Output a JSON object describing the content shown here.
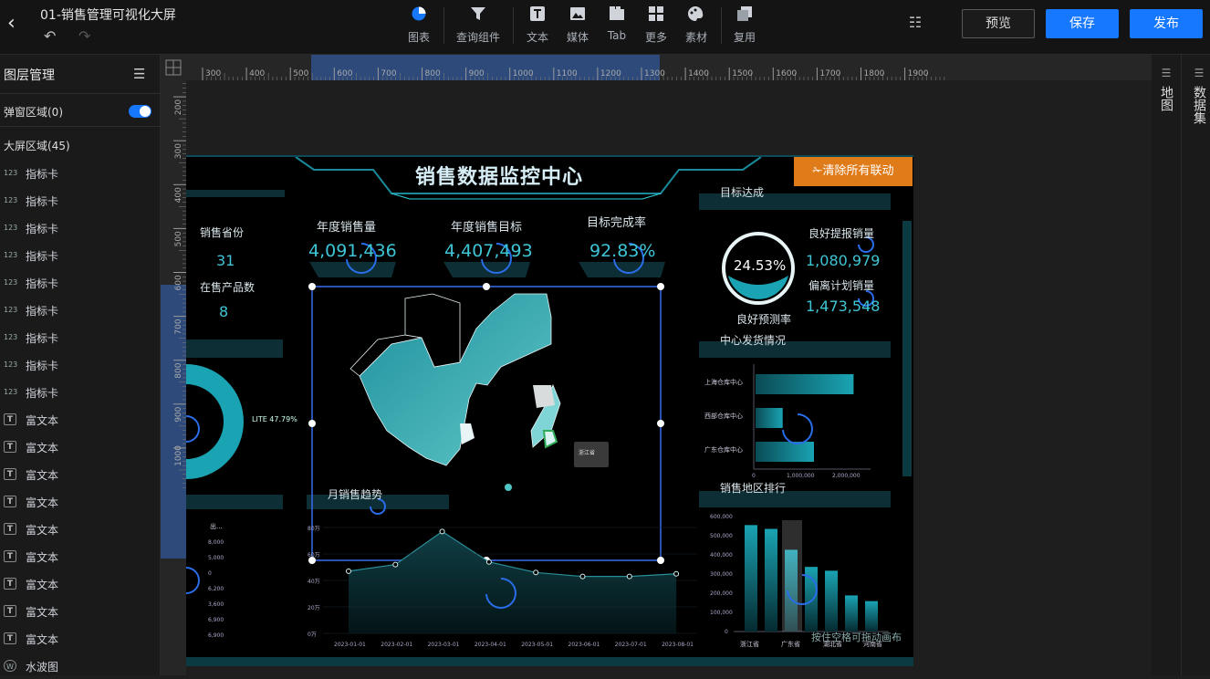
{
  "header": {
    "title": "01-销售管理可视化大屏",
    "back_icon": "chevron-left-icon",
    "undo_icon": "undo-icon",
    "redo_icon": "redo-icon"
  },
  "toolbar": {
    "items": [
      {
        "label": "图表",
        "icon": "pie-chart-icon"
      },
      {
        "label": "查询组件",
        "icon": "funnel-icon"
      },
      {
        "label": "文本",
        "icon": "text-icon"
      },
      {
        "label": "媒体",
        "icon": "image-icon"
      },
      {
        "label": "Tab",
        "icon": "tab-icon"
      },
      {
        "label": "更多",
        "icon": "grid-icon"
      },
      {
        "label": "素材",
        "icon": "palette-icon"
      },
      {
        "label": "复用",
        "icon": "copy-icon"
      }
    ]
  },
  "actions": {
    "preview": "预览",
    "save": "保存",
    "publish": "发布"
  },
  "colors": {
    "accent": "#1677ff",
    "teal": "#3ec5d6",
    "orange": "#e07b1a"
  },
  "left_panel": {
    "title": "图层管理",
    "popup_area": "弹窗区域(0)",
    "big_area": "大屏区域(45)",
    "layers": [
      {
        "type": "123",
        "name": "指标卡"
      },
      {
        "type": "123",
        "name": "指标卡"
      },
      {
        "type": "123",
        "name": "指标卡"
      },
      {
        "type": "123",
        "name": "指标卡"
      },
      {
        "type": "123",
        "name": "指标卡"
      },
      {
        "type": "123",
        "name": "指标卡"
      },
      {
        "type": "123",
        "name": "指标卡"
      },
      {
        "type": "123",
        "name": "指标卡"
      },
      {
        "type": "123",
        "name": "指标卡"
      },
      {
        "type": "T",
        "name": "富文本"
      },
      {
        "type": "T",
        "name": "富文本"
      },
      {
        "type": "T",
        "name": "富文本"
      },
      {
        "type": "T",
        "name": "富文本"
      },
      {
        "type": "T",
        "name": "富文本"
      },
      {
        "type": "T",
        "name": "富文本"
      },
      {
        "type": "T",
        "name": "富文本"
      },
      {
        "type": "T",
        "name": "富文本"
      },
      {
        "type": "T",
        "name": "富文本"
      },
      {
        "type": "W",
        "name": "水波图"
      }
    ]
  },
  "right_panel": {
    "map": "地图",
    "dataset": "数据集"
  },
  "ruler": {
    "top_ticks": [
      "300",
      "400",
      "500",
      "600",
      "700",
      "800",
      "900",
      "1000",
      "1100",
      "1200",
      "1300",
      "1400",
      "1500",
      "1600",
      "1700",
      "1800",
      "1900"
    ],
    "left_ticks": [
      "100",
      "200",
      "300",
      "400",
      "500",
      "600",
      "700",
      "800",
      "900",
      "1000"
    ]
  },
  "dashboard": {
    "title": "销售数据监控中心",
    "clear_button": "清除所有联动",
    "left_kpis": {
      "province_label": "销售省份",
      "province_value": "31",
      "product_label": "在售产品数",
      "product_value": "8"
    },
    "kpis": [
      {
        "label": "年度销售量",
        "value": "4,091,436"
      },
      {
        "label": "年度销售目标",
        "value": "4,407,493"
      },
      {
        "label": "目标完成率",
        "value": "92.83%"
      }
    ],
    "target": {
      "title": "目标达成",
      "percent": "24.53%",
      "percent_label": "良好预测率",
      "good_label": "良好提报销量",
      "good_value": "1,080,979",
      "dev_label": "偏离计划销量",
      "dev_value": "1,473,548"
    },
    "donut_label": "LITE 47.79%",
    "map": {
      "tooltip": "浙江省"
    },
    "warehouse": {
      "title": "中心发货情况",
      "axis": [
        "0",
        "1,000,000",
        "2,000,000"
      ],
      "chart_data": {
        "type": "bar",
        "categories": [
          "上海仓库中心",
          "西部仓库中心",
          "广东仓库中心"
        ],
        "values": [
          2350000,
          650000,
          1400000
        ],
        "xlim": [
          0,
          2800000
        ]
      }
    },
    "monthly": {
      "title": "月销售趋势",
      "chart_data": {
        "type": "area",
        "x": [
          "2023-01-01",
          "2023-02-01",
          "2023-03-01",
          "2023-04-01",
          "2023-05-01",
          "2023-06-01",
          "2023-07-01",
          "2023-08-01"
        ],
        "y": [
          470000,
          520000,
          770000,
          540000,
          460000,
          430000,
          430000,
          450000
        ],
        "yticks": [
          "0万",
          "20万",
          "40万",
          "60万",
          "80万"
        ],
        "ylim": [
          0,
          800000
        ]
      }
    },
    "left_table": {
      "header": "出...",
      "values": [
        "8,000",
        "5,000",
        "0",
        "6,200",
        "3,600",
        "6,900",
        "6,900"
      ]
    },
    "ranking": {
      "title": "销售地区排行",
      "chart_data": {
        "type": "bar",
        "categories": [
          "浙江省",
          "",
          "广东省",
          "",
          "湖北省",
          "",
          "河南省"
        ],
        "values": [
          560000,
          540000,
          430000,
          340000,
          320000,
          190000,
          160000
        ],
        "yticks": [
          "0",
          "100,000",
          "200,000",
          "300,000",
          "400,000",
          "500,000",
          "600,000"
        ],
        "ylim": [
          0,
          600000
        ]
      }
    },
    "hint": "按住空格可拖动画布"
  }
}
